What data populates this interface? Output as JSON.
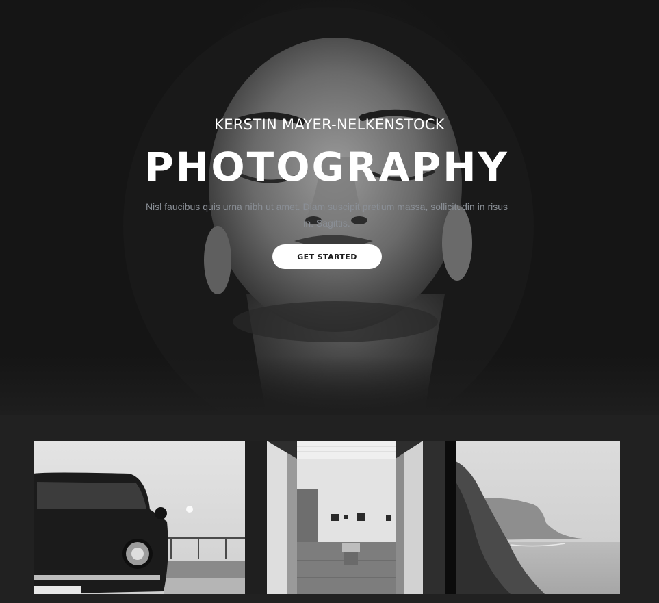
{
  "hero": {
    "subtitle": "KERSTIN MAYER-NELKENSTOCK",
    "title": "PHOTOGRAPHY",
    "description": "Nisl faucibus quis urna nibh ut amet. Diam suscipit pretium massa, sollicitudin in risus in. Sagittis.",
    "cta_label": "GET STARTED"
  },
  "gallery": {
    "items": [
      {
        "subject": "vintage car photo"
      },
      {
        "subject": "gallery interior photo"
      },
      {
        "subject": "coastal cliff photo"
      }
    ]
  },
  "colors": {
    "page_background": "#212121",
    "text_primary": "#ffffff",
    "text_muted": "#8a8f96",
    "button_background": "#ffffff",
    "button_text": "#1d1d1d"
  }
}
